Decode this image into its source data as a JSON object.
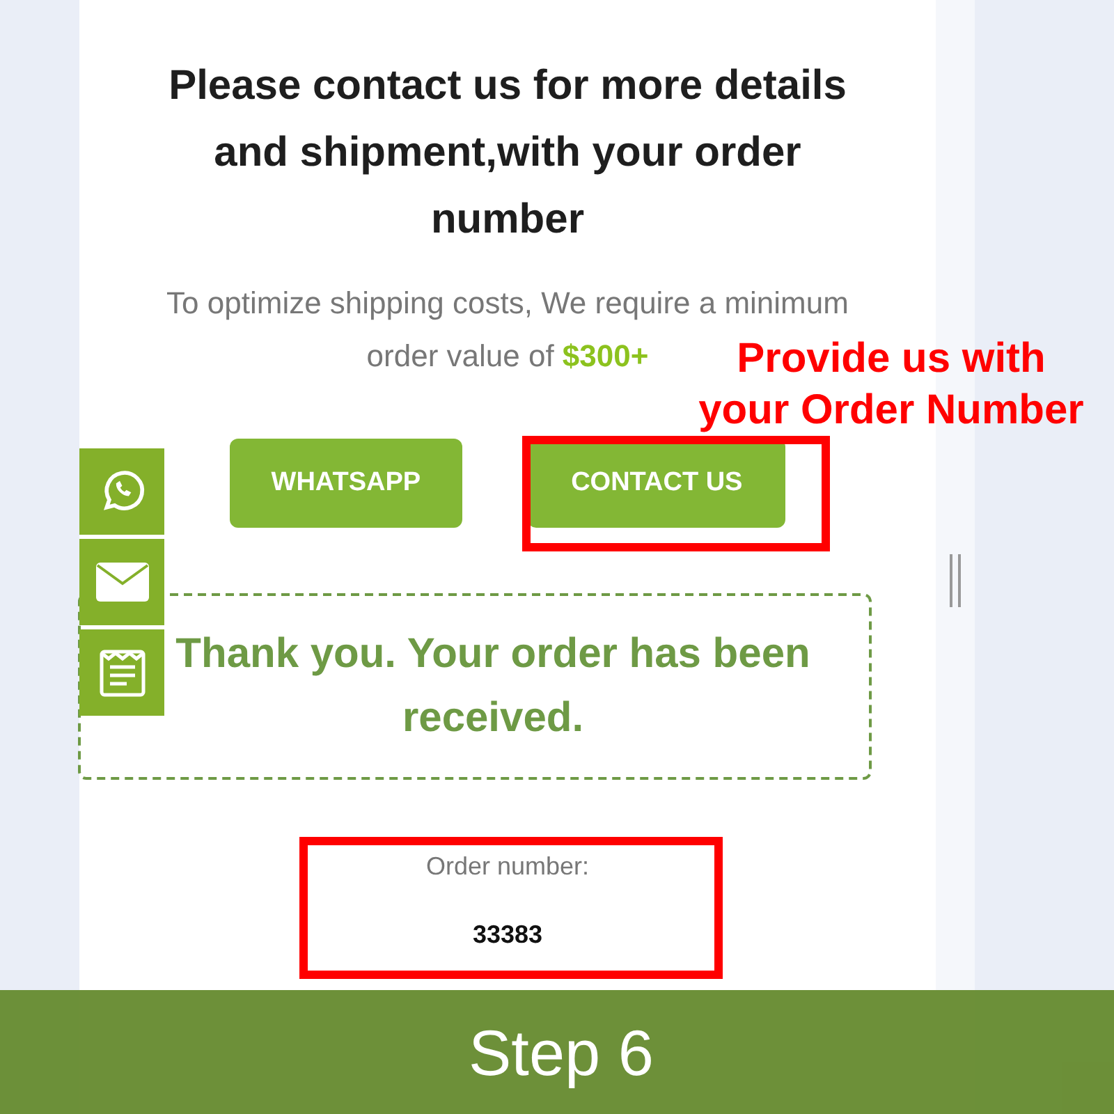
{
  "heading": "Please contact us for more details and shipment,with your order number",
  "note": [
    "To optimize shipping costs, We require a minimum",
    "order value of **$300+**"
  ],
  "buttons": [
    "WHATSAPP",
    "CONTACT US"
  ],
  "annotation": [
    "Provide us with",
    "your Order Number"
  ],
  "thank_you": "Thank you. Your order has been received.",
  "order_label": "Order number:",
  "order_number": "33383",
  "banner": "Step 6"
}
